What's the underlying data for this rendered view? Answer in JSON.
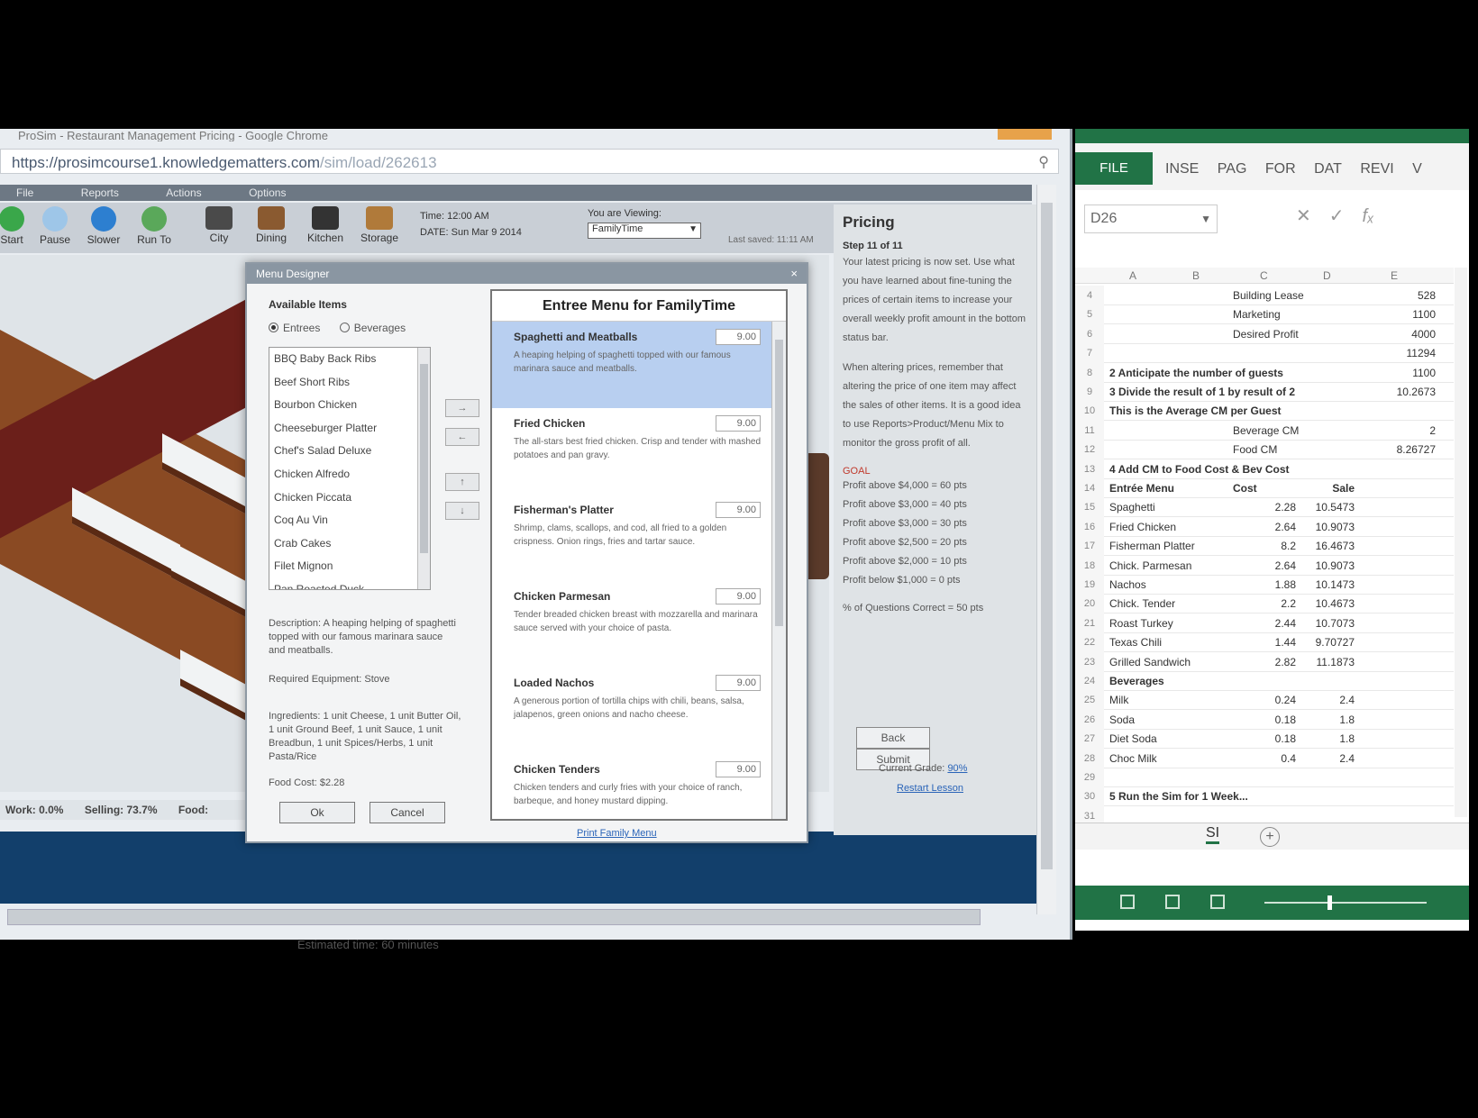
{
  "browser": {
    "title": "ProSim - Restaurant Management Pricing - Google Chrome",
    "url_main": "https://prosimcourse1.knowledgematters.com",
    "url_path": "/sim/load/262613"
  },
  "app_menu": [
    "File",
    "Reports",
    "Actions",
    "Options"
  ],
  "toolbar": {
    "tools": [
      {
        "label": "Start",
        "icon": "green-play-icon"
      },
      {
        "label": "Pause",
        "icon": "pause-icon"
      },
      {
        "label": "Slower",
        "icon": "slower-icon"
      },
      {
        "label": "Run To",
        "icon": "run-to-icon"
      },
      {
        "label": "City",
        "icon": "city-icon"
      },
      {
        "label": "Dining",
        "icon": "dining-icon"
      },
      {
        "label": "Kitchen",
        "icon": "kitchen-icon"
      },
      {
        "label": "Storage",
        "icon": "storage-icon"
      }
    ],
    "time": "Time: 12:00 AM",
    "date": "DATE: Sun Mar 9 2014",
    "viewing_label": "You are Viewing:",
    "viewing_value": "FamilyTime",
    "last_saved": "Last saved: 11:11 AM"
  },
  "status_strip": [
    "Work: 0.0%",
    "Selling: 73.7%",
    "Food:"
  ],
  "under_text": "Estimated time: 60 minutes",
  "pricing": {
    "heading": "Pricing",
    "step": "Step 11 of 11",
    "para1": "Your latest pricing is now set. Use what you have learned about fine-tuning the prices of certain items to increase your overall weekly profit amount in the bottom status bar.",
    "para2": "When altering prices, remember that altering the price of one item may affect the sales of other items. It is a good idea to use Reports>Product/Menu Mix to monitor the gross profit of all.",
    "goal_label": "GOAL",
    "tiers": [
      "Profit above $4,000 = 60 pts",
      "Profit above $3,000 = 40 pts",
      "Profit above $3,000 = 30 pts",
      "Profit above $2,500 = 20 pts",
      "Profit above $2,000 = 10 pts",
      "Profit below $1,000 = 0 pts"
    ],
    "questions": "% of Questions Correct = 50 pts",
    "back": "Back",
    "submit": "Submit",
    "current_grade_label": "Current Grade:",
    "current_grade": "90%",
    "restart": "Restart Lesson"
  },
  "dialog": {
    "title": "Menu Designer",
    "available_heading": "Available Items",
    "radio_entrees": "Entrees",
    "radio_beverages": "Beverages",
    "available_items": [
      "BBQ Baby Back Ribs",
      "Beef Short Ribs",
      "Bourbon Chicken",
      "Cheeseburger Platter",
      "Chef's Salad Deluxe",
      "Chicken Alfredo",
      "Chicken Piccata",
      "Coq Au Vin",
      "Crab Cakes",
      "Filet Mignon",
      "Pan Roasted Duck"
    ],
    "description": "Description: A heaping helping of spaghetti topped with our famous marinara sauce and meatballs.",
    "equipment": "Required Equipment: Stove",
    "ingredients": "Ingredients: 1 unit Cheese, 1 unit Butter Oil, 1 unit Ground Beef, 1 unit Sauce, 1 unit Breadbun, 1 unit Spices/Herbs, 1 unit Pasta/Rice",
    "food_cost": "Food Cost: $2.28",
    "ok": "Ok",
    "cancel": "Cancel",
    "entree_title": "Entree Menu for FamilyTime",
    "entrees": [
      {
        "name": "Spaghetti and Meatballs",
        "price": "9.00",
        "desc": "A heaping helping of spaghetti topped with our famous marinara sauce and meatballs."
      },
      {
        "name": "Fried Chicken",
        "price": "9.00",
        "desc": "The all-stars best fried chicken. Crisp and tender with mashed potatoes and pan gravy."
      },
      {
        "name": "Fisherman's Platter",
        "price": "9.00",
        "desc": "Shrimp, clams, scallops, and cod, all fried to a golden crispness. Onion rings, fries and tartar sauce."
      },
      {
        "name": "Chicken Parmesan",
        "price": "9.00",
        "desc": "Tender breaded chicken breast with mozzarella and marinara sauce served with your choice of pasta."
      },
      {
        "name": "Loaded Nachos",
        "price": "9.00",
        "desc": "A generous portion of tortilla chips with chili, beans, salsa, jalapenos, green onions and nacho cheese."
      },
      {
        "name": "Chicken Tenders",
        "price": "9.00",
        "desc": "Chicken tenders and curly fries with your choice of ranch, barbeque, and honey mustard dipping."
      }
    ],
    "print_link": "Print Family Menu"
  },
  "excel": {
    "file_tab": "FILE",
    "tabs": [
      "INSE",
      "PAG",
      "FOR",
      "DAT",
      "REVI",
      "V"
    ],
    "name_box": "D26",
    "columns": [
      "A",
      "B",
      "C",
      "D",
      "E"
    ],
    "sheet_tab": "SI",
    "rows": [
      {
        "n": "4",
        "a": "",
        "c": "Building Lease",
        "d": "",
        "e": "528"
      },
      {
        "n": "5",
        "a": "",
        "c": "Marketing",
        "d": "",
        "e": "1100"
      },
      {
        "n": "6",
        "a": "",
        "c": "Desired Profit",
        "d": "",
        "e": "4000"
      },
      {
        "n": "7",
        "a": "",
        "c": "",
        "d": "",
        "e": "11294"
      },
      {
        "n": "8",
        "a": "2 Anticipate the number of guests",
        "c": "",
        "d": "",
        "e": "1100",
        "bold": true
      },
      {
        "n": "9",
        "a": "3 Divide the result of 1 by result of 2",
        "c": "",
        "d": "",
        "e": "10.2673",
        "bold": true
      },
      {
        "n": "10",
        "a": "This is the Average CM per Guest",
        "c": "",
        "d": "",
        "e": "",
        "bold": true
      },
      {
        "n": "11",
        "a": "",
        "c": "Beverage CM",
        "d": "",
        "e": "2"
      },
      {
        "n": "12",
        "a": "",
        "c": "Food CM",
        "d": "",
        "e": "8.26727"
      },
      {
        "n": "13",
        "a": "4 Add CM to Food Cost & Bev Cost",
        "c": "",
        "d": "",
        "e": "",
        "bold": true
      },
      {
        "n": "14",
        "a": "Entrée Menu",
        "c": "Cost",
        "d": "Sale",
        "e": "",
        "bold": true
      },
      {
        "n": "15",
        "a": "Spaghetti",
        "c": "2.28",
        "d": "10.5473",
        "e": ""
      },
      {
        "n": "16",
        "a": "Fried Chicken",
        "c": "2.64",
        "d": "10.9073",
        "e": ""
      },
      {
        "n": "17",
        "a": "Fisherman Platter",
        "c": "8.2",
        "d": "16.4673",
        "e": ""
      },
      {
        "n": "18",
        "a": "Chick. Parmesan",
        "c": "2.64",
        "d": "10.9073",
        "e": ""
      },
      {
        "n": "19",
        "a": "Nachos",
        "c": "1.88",
        "d": "10.1473",
        "e": ""
      },
      {
        "n": "20",
        "a": "Chick. Tender",
        "c": "2.2",
        "d": "10.4673",
        "e": ""
      },
      {
        "n": "21",
        "a": "Roast Turkey",
        "c": "2.44",
        "d": "10.7073",
        "e": ""
      },
      {
        "n": "22",
        "a": "Texas Chili",
        "c": "1.44",
        "d": "9.70727",
        "e": ""
      },
      {
        "n": "23",
        "a": "Grilled Sandwich",
        "c": "2.82",
        "d": "11.1873",
        "e": ""
      },
      {
        "n": "24",
        "a": "Beverages",
        "c": "",
        "d": "",
        "e": "",
        "bold": true
      },
      {
        "n": "25",
        "a": "Milk",
        "c": "0.24",
        "d": "2.4",
        "e": ""
      },
      {
        "n": "26",
        "a": "Soda",
        "c": "0.18",
        "d": "1.8",
        "e": ""
      },
      {
        "n": "27",
        "a": "Diet Soda",
        "c": "0.18",
        "d": "1.8",
        "e": ""
      },
      {
        "n": "28",
        "a": "Choc Milk",
        "c": "0.4",
        "d": "2.4",
        "e": ""
      },
      {
        "n": "29",
        "a": "",
        "c": "",
        "d": "",
        "e": ""
      },
      {
        "n": "30",
        "a": "5 Run the Sim for 1 Week...",
        "c": "",
        "d": "",
        "e": "",
        "bold": true
      },
      {
        "n": "31",
        "a": "",
        "c": "",
        "d": "",
        "e": ""
      }
    ]
  },
  "colors": {
    "excel_green": "#217346",
    "selection_blue": "#b8cff0",
    "footer_navy": "#123f6b"
  }
}
